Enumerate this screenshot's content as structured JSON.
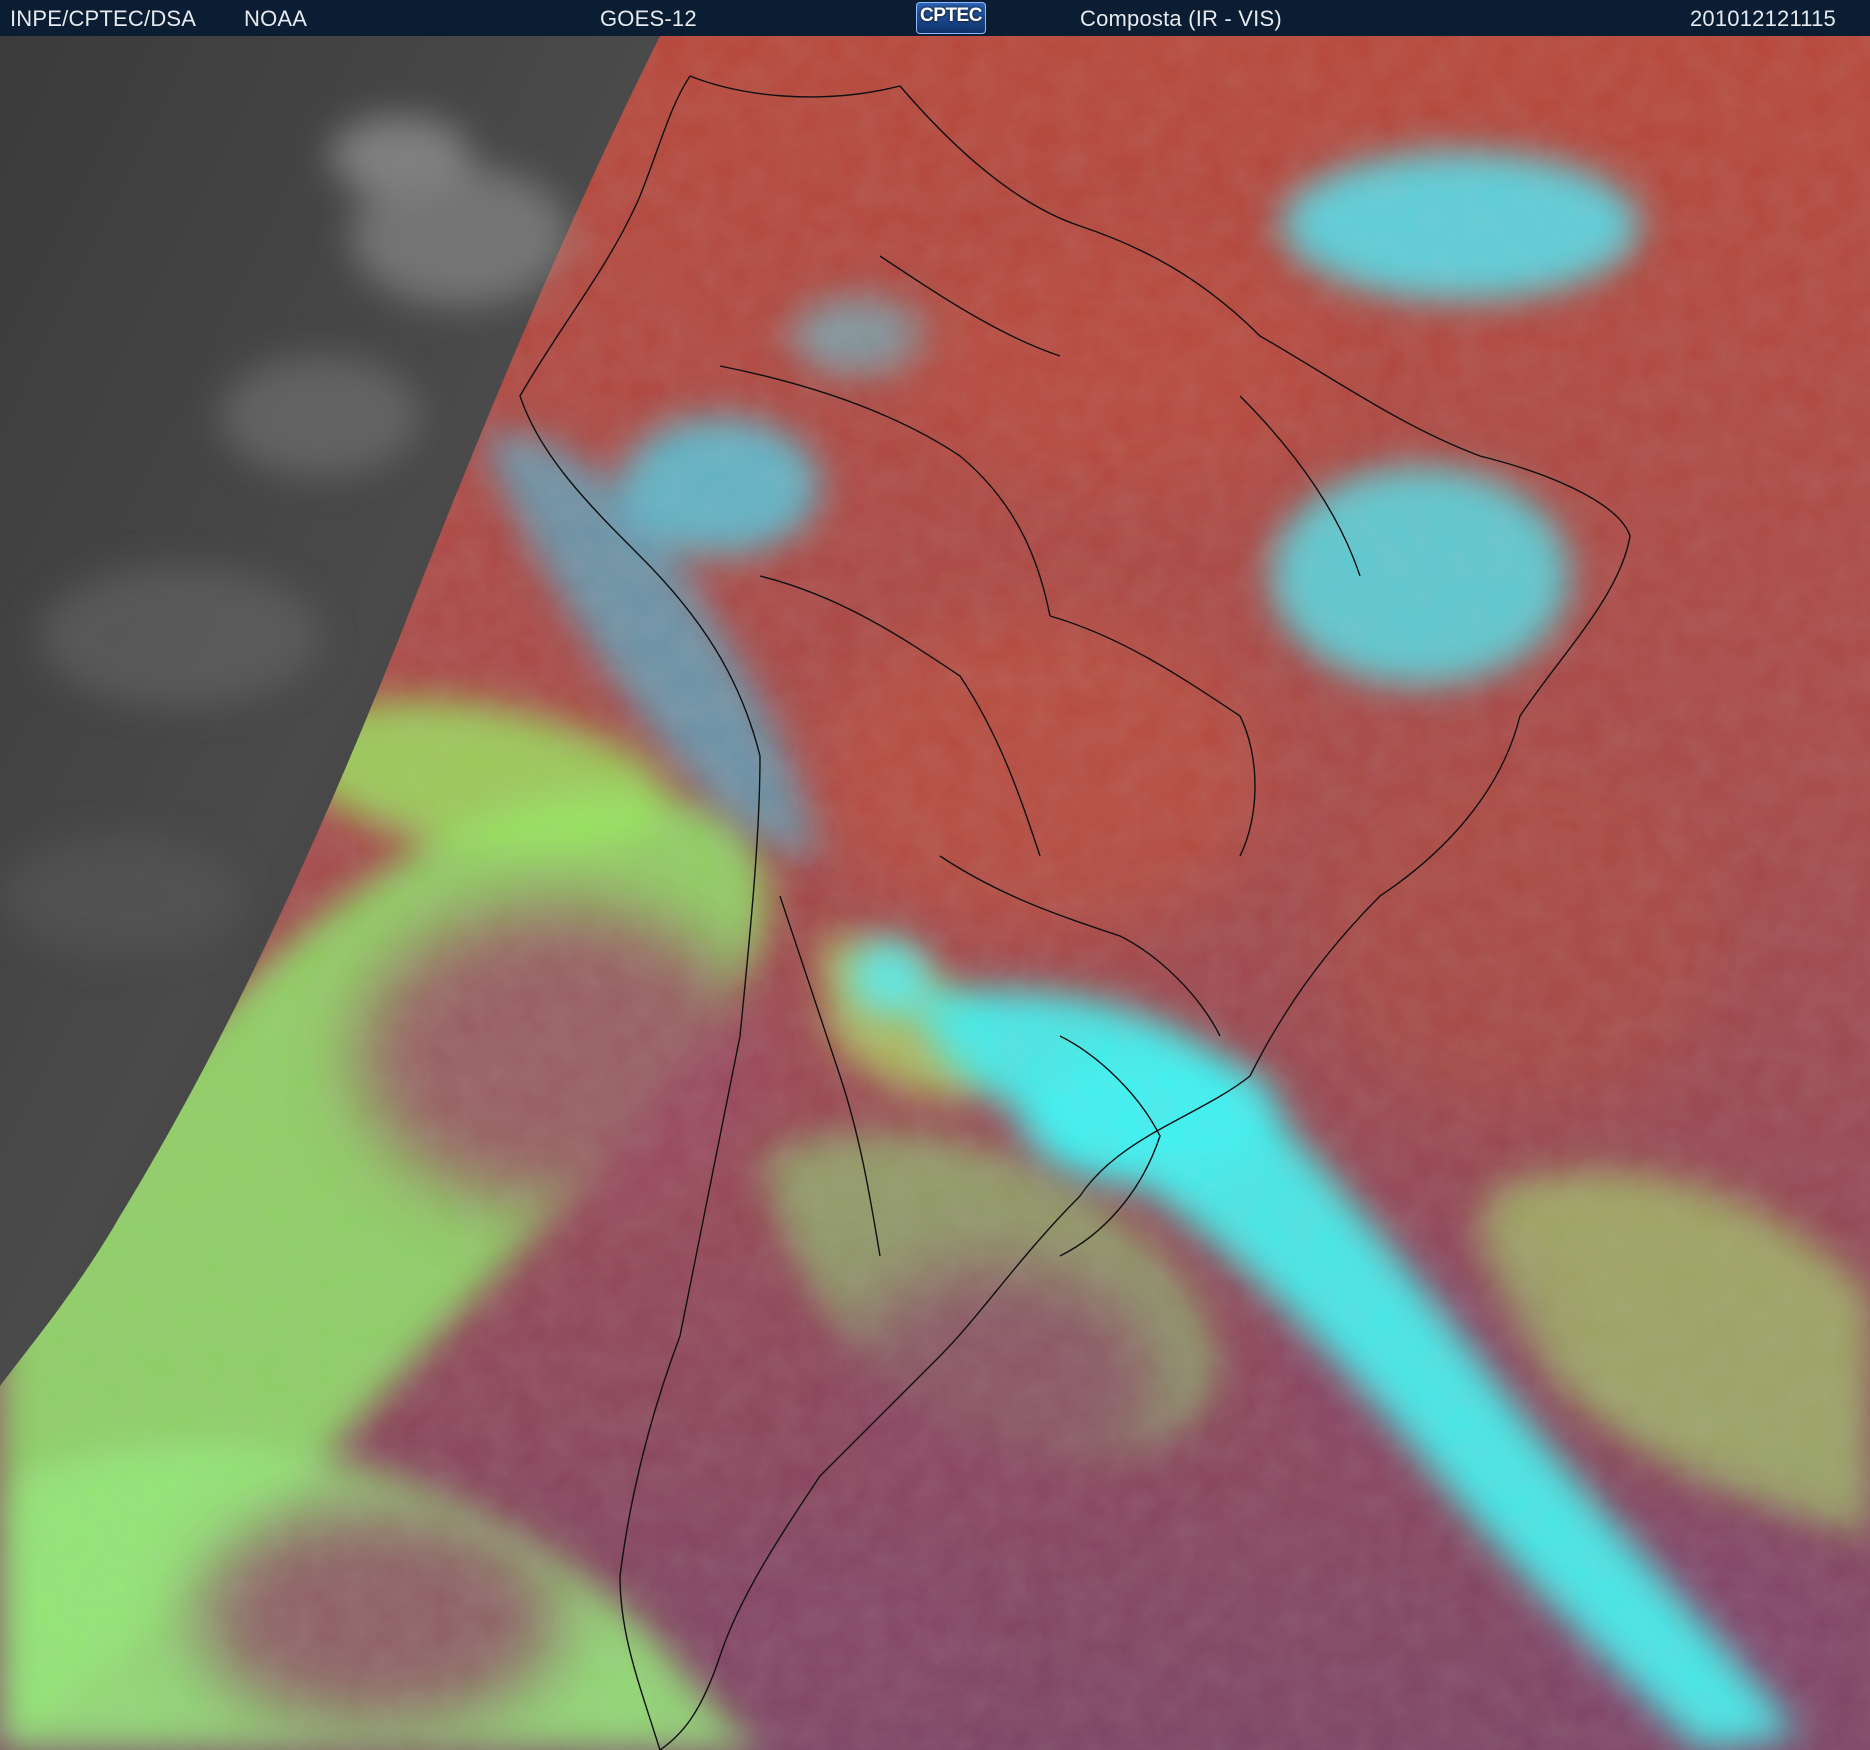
{
  "header": {
    "agency": "INPE/CPTEC/DSA",
    "partner": "NOAA",
    "satellite": "GOES-12",
    "logo_text": "CPTEC",
    "product": "Composta (IR - VIS)",
    "timestamp": "201012121115"
  },
  "map": {
    "palette": {
      "night_gray": "#3a3a3a",
      "land_red": "#b84a3c",
      "cloud_cyan": "#3ff0f0",
      "cloud_green": "#8fe86a",
      "ocean_magenta": "#8a4a64",
      "background": "#0b1d33"
    }
  }
}
